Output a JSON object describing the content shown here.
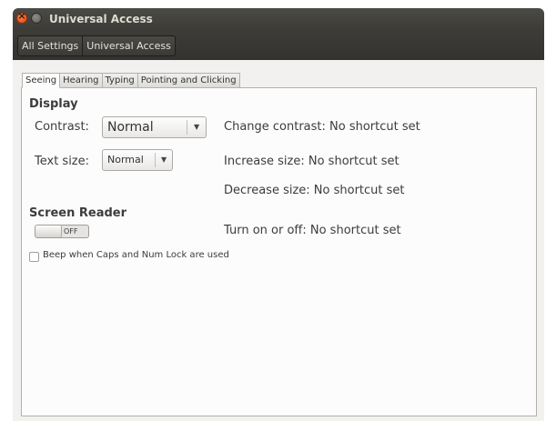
{
  "window": {
    "title": "Universal Access"
  },
  "breadcrumb": [
    "All Settings",
    "Universal Access"
  ],
  "tabs": [
    "Seeing",
    "Hearing",
    "Typing",
    "Pointing and Clicking"
  ],
  "display": {
    "heading": "Display",
    "contrast_label": "Contrast:",
    "contrast_value": "Normal",
    "contrast_shortcut": "Change contrast: No shortcut set",
    "textsize_label": "Text size:",
    "textsize_value": "Normal",
    "increase_shortcut": "Increase size: No shortcut set",
    "decrease_shortcut": "Decrease size: No shortcut set"
  },
  "screen_reader": {
    "heading": "Screen Reader",
    "toggle_state": "OFF",
    "shortcut": "Turn on or off: No shortcut set"
  },
  "beep": {
    "label": "Beep when Caps and Num Lock are used",
    "checked": false
  }
}
